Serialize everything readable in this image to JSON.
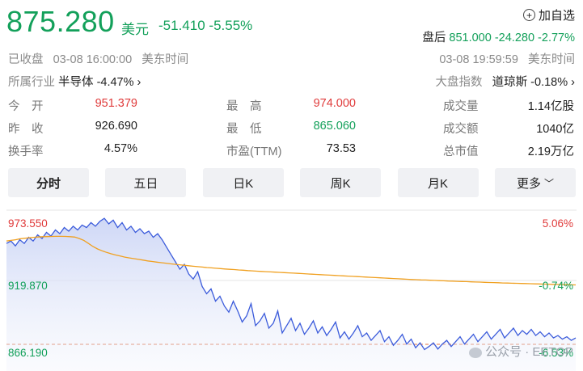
{
  "quote": {
    "price": "875.280",
    "currency": "美元",
    "change": "-51.410",
    "change_pct": "-5.55%",
    "watchlist_label": "加自选",
    "status": "已收盘",
    "time": "03-08 16:00:00",
    "tz": "美东时间"
  },
  "after_hours": {
    "label": "盘后",
    "price": "851.000",
    "change": "-24.280",
    "change_pct": "-2.77%",
    "time": "03-08 19:59:59",
    "tz": "美东时间"
  },
  "industry": {
    "label": "所属行业",
    "name": "半导体",
    "change_pct": "-4.47%"
  },
  "index": {
    "label": "大盘指数",
    "name": "道琼斯",
    "change_pct": "-0.18%"
  },
  "stats": {
    "open_label": "今　开",
    "open": "951.379",
    "high_label": "最　高",
    "high": "974.000",
    "volume_label": "成交量",
    "volume": "1.14亿股",
    "prev_close_label": "昨　收",
    "prev_close": "926.690",
    "low_label": "最　低",
    "low": "865.060",
    "turnover_label": "成交额",
    "turnover": "1040亿",
    "turnover_rate_label": "换手率",
    "turnover_rate": "4.57%",
    "pe_label": "市盈(TTM)",
    "pe": "73.53",
    "mktcap_label": "总市值",
    "mktcap": "2.19万亿"
  },
  "tabs": [
    "分时",
    "五日",
    "日K",
    "周K",
    "月K",
    "更多"
  ],
  "colors": {
    "up": "#e03b3b",
    "down": "#13a05a",
    "price_line": "#3b5bdb",
    "avg_line": "#f0a020"
  },
  "watermark": "公众号 · EETOP",
  "chart_data": {
    "type": "line",
    "y_left_labels": [
      "973.550",
      "919.870",
      "866.190"
    ],
    "y_right_labels": [
      "5.06%",
      "-0.74%",
      "-6.53%"
    ],
    "ylim": [
      866.19,
      973.55
    ],
    "prev_close": 926.69,
    "series": [
      {
        "values": [
          953,
          955,
          951,
          956,
          953,
          958,
          955,
          960,
          957,
          962,
          959,
          964,
          961,
          966,
          963,
          967,
          964,
          968,
          966,
          970,
          967,
          971,
          973.5,
          969,
          972,
          966,
          970,
          964,
          967,
          962,
          965,
          961,
          963,
          958,
          961,
          956,
          950,
          944,
          938,
          932,
          936,
          928,
          924,
          930,
          918,
          912,
          916,
          906,
          910,
          902,
          897,
          906,
          898,
          889,
          894,
          904,
          886,
          890,
          896,
          884,
          888,
          898,
          880,
          886,
          892,
          882,
          888,
          879,
          884,
          890,
          880,
          885,
          878,
          883,
          889,
          876,
          881,
          875,
          880,
          886,
          877,
          880,
          874,
          878,
          882,
          873,
          877,
          870,
          874,
          879,
          871,
          875,
          868,
          872,
          866.5,
          869,
          872,
          867,
          871,
          874,
          869,
          873,
          877,
          871,
          875,
          879,
          873,
          877,
          881,
          875,
          879,
          883,
          876,
          880,
          884,
          878,
          882,
          879,
          883,
          878,
          881,
          877,
          880,
          876,
          878,
          875,
          877,
          874,
          876
        ]
      },
      {
        "values": [
          955,
          955.5,
          956,
          956.8,
          957.2,
          957.6,
          958,
          958.3,
          958.5,
          958.6,
          958.7,
          958.8,
          958.8,
          958.7,
          958.5,
          958.2,
          957,
          955.5,
          953,
          950.5,
          948.5,
          947,
          945.7,
          944.6,
          943.6,
          942.7,
          941.9,
          941.2,
          940.6,
          940,
          939.4,
          938.8,
          938.3,
          937.8,
          937.3,
          936.9,
          936.4,
          936,
          935.6,
          935.2,
          934.8,
          934.4,
          934.1,
          933.8,
          933.4,
          933.1,
          932.8,
          932.5,
          932.2,
          931.9,
          931.7,
          931.4,
          931.2,
          930.9,
          930.7,
          930.4,
          930.2,
          930,
          929.8,
          929.6,
          929.4,
          929.2,
          929,
          928.8,
          928.6,
          928.4,
          928.2,
          928,
          927.8,
          927.6,
          927.4,
          927.2,
          927,
          926.8,
          926.6,
          926.4,
          926.2,
          926,
          925.8,
          925.6,
          925.4,
          925.2,
          925,
          924.8,
          924.6,
          924.4,
          924.2,
          924,
          923.8,
          923.6,
          923.5,
          923.3,
          923.2,
          923,
          922.9,
          922.7,
          922.6,
          922.4,
          922.3,
          922.1,
          922,
          921.9,
          921.7,
          921.6,
          921.5,
          921.3,
          921.2,
          921.1,
          921,
          920.8,
          920.7,
          920.6,
          920.5,
          920.4,
          920.3,
          920.2,
          920.1,
          920,
          919.9,
          919.8,
          919.7,
          919.6,
          919.5,
          919.4,
          919.3,
          919.2
        ]
      }
    ]
  }
}
